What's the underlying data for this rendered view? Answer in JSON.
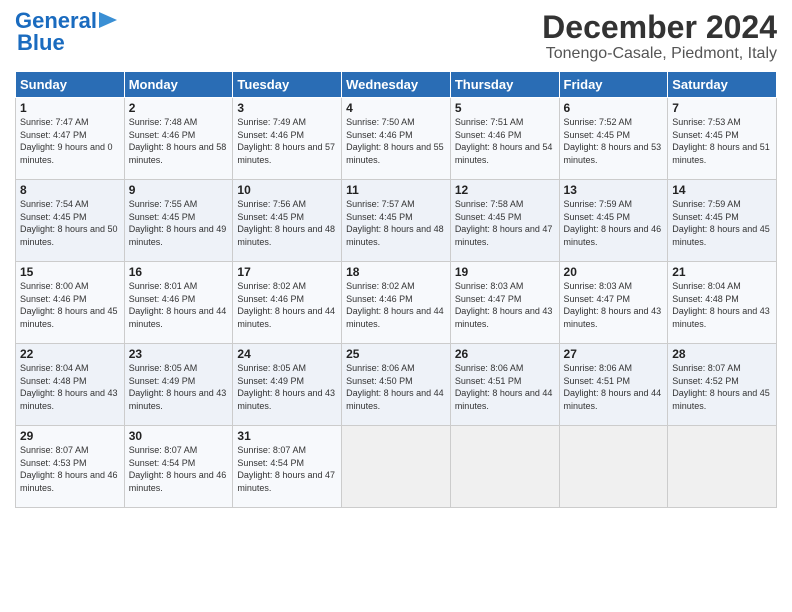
{
  "logo": {
    "line1": "General",
    "line2": "Blue"
  },
  "title": "December 2024",
  "subtitle": "Tonengo-Casale, Piedmont, Italy",
  "days_of_week": [
    "Sunday",
    "Monday",
    "Tuesday",
    "Wednesday",
    "Thursday",
    "Friday",
    "Saturday"
  ],
  "weeks": [
    [
      {
        "day": "1",
        "sunrise": "Sunrise: 7:47 AM",
        "sunset": "Sunset: 4:47 PM",
        "daylight": "Daylight: 9 hours and 0 minutes."
      },
      {
        "day": "2",
        "sunrise": "Sunrise: 7:48 AM",
        "sunset": "Sunset: 4:46 PM",
        "daylight": "Daylight: 8 hours and 58 minutes."
      },
      {
        "day": "3",
        "sunrise": "Sunrise: 7:49 AM",
        "sunset": "Sunset: 4:46 PM",
        "daylight": "Daylight: 8 hours and 57 minutes."
      },
      {
        "day": "4",
        "sunrise": "Sunrise: 7:50 AM",
        "sunset": "Sunset: 4:46 PM",
        "daylight": "Daylight: 8 hours and 55 minutes."
      },
      {
        "day": "5",
        "sunrise": "Sunrise: 7:51 AM",
        "sunset": "Sunset: 4:46 PM",
        "daylight": "Daylight: 8 hours and 54 minutes."
      },
      {
        "day": "6",
        "sunrise": "Sunrise: 7:52 AM",
        "sunset": "Sunset: 4:45 PM",
        "daylight": "Daylight: 8 hours and 53 minutes."
      },
      {
        "day": "7",
        "sunrise": "Sunrise: 7:53 AM",
        "sunset": "Sunset: 4:45 PM",
        "daylight": "Daylight: 8 hours and 51 minutes."
      }
    ],
    [
      {
        "day": "8",
        "sunrise": "Sunrise: 7:54 AM",
        "sunset": "Sunset: 4:45 PM",
        "daylight": "Daylight: 8 hours and 50 minutes."
      },
      {
        "day": "9",
        "sunrise": "Sunrise: 7:55 AM",
        "sunset": "Sunset: 4:45 PM",
        "daylight": "Daylight: 8 hours and 49 minutes."
      },
      {
        "day": "10",
        "sunrise": "Sunrise: 7:56 AM",
        "sunset": "Sunset: 4:45 PM",
        "daylight": "Daylight: 8 hours and 48 minutes."
      },
      {
        "day": "11",
        "sunrise": "Sunrise: 7:57 AM",
        "sunset": "Sunset: 4:45 PM",
        "daylight": "Daylight: 8 hours and 48 minutes."
      },
      {
        "day": "12",
        "sunrise": "Sunrise: 7:58 AM",
        "sunset": "Sunset: 4:45 PM",
        "daylight": "Daylight: 8 hours and 47 minutes."
      },
      {
        "day": "13",
        "sunrise": "Sunrise: 7:59 AM",
        "sunset": "Sunset: 4:45 PM",
        "daylight": "Daylight: 8 hours and 46 minutes."
      },
      {
        "day": "14",
        "sunrise": "Sunrise: 7:59 AM",
        "sunset": "Sunset: 4:45 PM",
        "daylight": "Daylight: 8 hours and 45 minutes."
      }
    ],
    [
      {
        "day": "15",
        "sunrise": "Sunrise: 8:00 AM",
        "sunset": "Sunset: 4:46 PM",
        "daylight": "Daylight: 8 hours and 45 minutes."
      },
      {
        "day": "16",
        "sunrise": "Sunrise: 8:01 AM",
        "sunset": "Sunset: 4:46 PM",
        "daylight": "Daylight: 8 hours and 44 minutes."
      },
      {
        "day": "17",
        "sunrise": "Sunrise: 8:02 AM",
        "sunset": "Sunset: 4:46 PM",
        "daylight": "Daylight: 8 hours and 44 minutes."
      },
      {
        "day": "18",
        "sunrise": "Sunrise: 8:02 AM",
        "sunset": "Sunset: 4:46 PM",
        "daylight": "Daylight: 8 hours and 44 minutes."
      },
      {
        "day": "19",
        "sunrise": "Sunrise: 8:03 AM",
        "sunset": "Sunset: 4:47 PM",
        "daylight": "Daylight: 8 hours and 43 minutes."
      },
      {
        "day": "20",
        "sunrise": "Sunrise: 8:03 AM",
        "sunset": "Sunset: 4:47 PM",
        "daylight": "Daylight: 8 hours and 43 minutes."
      },
      {
        "day": "21",
        "sunrise": "Sunrise: 8:04 AM",
        "sunset": "Sunset: 4:48 PM",
        "daylight": "Daylight: 8 hours and 43 minutes."
      }
    ],
    [
      {
        "day": "22",
        "sunrise": "Sunrise: 8:04 AM",
        "sunset": "Sunset: 4:48 PM",
        "daylight": "Daylight: 8 hours and 43 minutes."
      },
      {
        "day": "23",
        "sunrise": "Sunrise: 8:05 AM",
        "sunset": "Sunset: 4:49 PM",
        "daylight": "Daylight: 8 hours and 43 minutes."
      },
      {
        "day": "24",
        "sunrise": "Sunrise: 8:05 AM",
        "sunset": "Sunset: 4:49 PM",
        "daylight": "Daylight: 8 hours and 43 minutes."
      },
      {
        "day": "25",
        "sunrise": "Sunrise: 8:06 AM",
        "sunset": "Sunset: 4:50 PM",
        "daylight": "Daylight: 8 hours and 44 minutes."
      },
      {
        "day": "26",
        "sunrise": "Sunrise: 8:06 AM",
        "sunset": "Sunset: 4:51 PM",
        "daylight": "Daylight: 8 hours and 44 minutes."
      },
      {
        "day": "27",
        "sunrise": "Sunrise: 8:06 AM",
        "sunset": "Sunset: 4:51 PM",
        "daylight": "Daylight: 8 hours and 44 minutes."
      },
      {
        "day": "28",
        "sunrise": "Sunrise: 8:07 AM",
        "sunset": "Sunset: 4:52 PM",
        "daylight": "Daylight: 8 hours and 45 minutes."
      }
    ],
    [
      {
        "day": "29",
        "sunrise": "Sunrise: 8:07 AM",
        "sunset": "Sunset: 4:53 PM",
        "daylight": "Daylight: 8 hours and 46 minutes."
      },
      {
        "day": "30",
        "sunrise": "Sunrise: 8:07 AM",
        "sunset": "Sunset: 4:54 PM",
        "daylight": "Daylight: 8 hours and 46 minutes."
      },
      {
        "day": "31",
        "sunrise": "Sunrise: 8:07 AM",
        "sunset": "Sunset: 4:54 PM",
        "daylight": "Daylight: 8 hours and 47 minutes."
      },
      {
        "day": "",
        "sunrise": "",
        "sunset": "",
        "daylight": ""
      },
      {
        "day": "",
        "sunrise": "",
        "sunset": "",
        "daylight": ""
      },
      {
        "day": "",
        "sunrise": "",
        "sunset": "",
        "daylight": ""
      },
      {
        "day": "",
        "sunrise": "",
        "sunset": "",
        "daylight": ""
      }
    ]
  ]
}
